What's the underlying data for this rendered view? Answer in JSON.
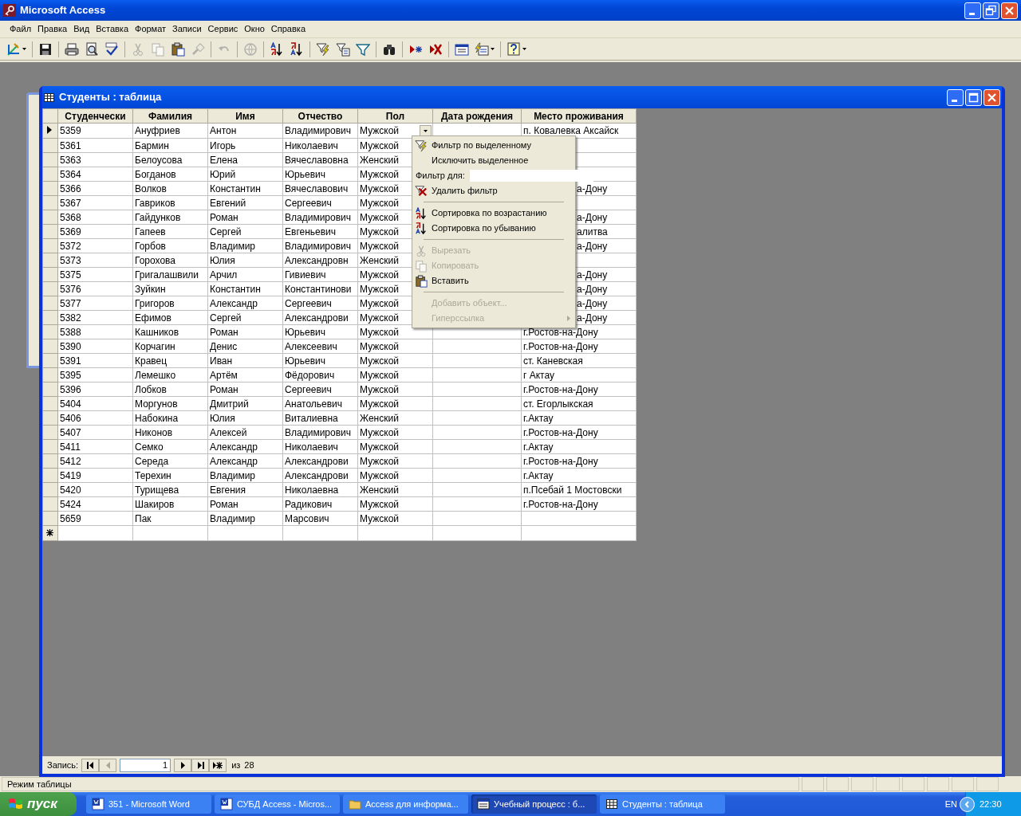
{
  "app": {
    "title": "Microsoft Access"
  },
  "menu_bar": [
    "Файл",
    "Правка",
    "Вид",
    "Вставка",
    "Формат",
    "Записи",
    "Сервис",
    "Окно",
    "Справка"
  ],
  "toolbar": [
    {
      "kind": "design-view",
      "disabled": false,
      "dropdown": true
    },
    {
      "kind": "save",
      "disabled": false,
      "dropdown": false
    },
    {
      "kind": "print",
      "disabled": false,
      "dropdown": false
    },
    {
      "kind": "preview",
      "disabled": false,
      "dropdown": false
    },
    {
      "kind": "spelling",
      "disabled": false,
      "dropdown": false
    },
    {
      "kind": "cut",
      "disabled": true,
      "dropdown": false
    },
    {
      "kind": "copy",
      "disabled": true,
      "dropdown": false
    },
    {
      "kind": "paste",
      "disabled": false,
      "dropdown": false
    },
    {
      "kind": "brush",
      "disabled": true,
      "dropdown": false
    },
    {
      "kind": "undo",
      "disabled": true,
      "dropdown": false
    },
    {
      "kind": "globe",
      "disabled": true,
      "dropdown": false
    },
    {
      "kind": "sort-asc",
      "disabled": false,
      "dropdown": false
    },
    {
      "kind": "sort-desc",
      "disabled": false,
      "dropdown": false
    },
    {
      "kind": "filter-selection",
      "disabled": false,
      "dropdown": false
    },
    {
      "kind": "filter-form",
      "disabled": false,
      "dropdown": false
    },
    {
      "kind": "filter",
      "disabled": false,
      "dropdown": false
    },
    {
      "kind": "find",
      "disabled": false,
      "dropdown": false
    },
    {
      "kind": "new-record",
      "disabled": false,
      "dropdown": false
    },
    {
      "kind": "delete-record",
      "disabled": false,
      "dropdown": false
    },
    {
      "kind": "database",
      "disabled": false,
      "dropdown": false
    },
    {
      "kind": "new-object",
      "disabled": false,
      "dropdown": true
    },
    {
      "kind": "help",
      "disabled": false,
      "dropdown": true
    }
  ],
  "table_window": {
    "title": "Студенты : таблица",
    "columns": [
      "Студенчески",
      "Фамилия",
      "Имя",
      "Отчество",
      "Пол",
      "Дата рождения",
      "Место проживания"
    ],
    "rows": [
      {
        "selected": true,
        "cells": [
          "5359",
          "Ануфриев",
          "Антон",
          "Владимирович",
          "Мужской",
          "",
          "п. Ковалевка Аксайск"
        ]
      },
      {
        "selected": false,
        "cells": [
          "5361",
          "Бармин",
          "Игорь",
          "Николаевич",
          "Мужской",
          "",
          ""
        ]
      },
      {
        "selected": false,
        "cells": [
          "5363",
          "Белоусова",
          "Елена",
          "Вячеславовна",
          "Женский",
          "",
          ""
        ]
      },
      {
        "selected": false,
        "cells": [
          "5364",
          "Богданов",
          "Юрий",
          "Юрьевич",
          "Мужской",
          "",
          ""
        ]
      },
      {
        "selected": false,
        "cells": [
          "5366",
          "Волков",
          "Константин",
          "Вячеславович",
          "Мужской",
          "",
          "а-Дону"
        ]
      },
      {
        "selected": false,
        "cells": [
          "5367",
          "Гавриков",
          "Евгений",
          "Сергеевич",
          "Мужской",
          "",
          ""
        ]
      },
      {
        "selected": false,
        "cells": [
          "5368",
          "Гайдунков",
          "Роман",
          "Владимирович",
          "Мужской",
          "",
          "а-Дону"
        ]
      },
      {
        "selected": false,
        "cells": [
          "5369",
          "Гапеев",
          "Сергей",
          "Евгеньевич",
          "Мужской",
          "",
          "алитва"
        ]
      },
      {
        "selected": false,
        "cells": [
          "5372",
          "Горбов",
          "Владимир",
          "Владимирович",
          "Мужской",
          "",
          "а-Дону"
        ]
      },
      {
        "selected": false,
        "cells": [
          "5373",
          "Горохова",
          "Юлия",
          "Александровн",
          "Женский",
          "",
          ""
        ]
      },
      {
        "selected": false,
        "cells": [
          "5375",
          "Григалашвили",
          "Арчил",
          "Гивиевич",
          "Мужской",
          "",
          "а-Дону"
        ]
      },
      {
        "selected": false,
        "cells": [
          "5376",
          "Зуйкин",
          "Константин",
          "Константинови",
          "Мужской",
          "",
          "а-Дону"
        ]
      },
      {
        "selected": false,
        "cells": [
          "5377",
          "Григоров",
          "Александр",
          "Сергеевич",
          "Мужской",
          "",
          "а-Дону"
        ]
      },
      {
        "selected": false,
        "cells": [
          "5382",
          "Ефимов",
          "Сергей",
          "Александрови",
          "Мужской",
          "",
          "а-Дону"
        ]
      },
      {
        "selected": false,
        "cells": [
          "5388",
          "Кашников",
          "Роман",
          "Юрьевич",
          "Мужской",
          "",
          "г.Ростов-на-Дону"
        ]
      },
      {
        "selected": false,
        "cells": [
          "5390",
          "Корчагин",
          "Денис",
          "Алексеевич",
          "Мужской",
          "",
          "г.Ростов-на-Дону"
        ]
      },
      {
        "selected": false,
        "cells": [
          "5391",
          "Кравец",
          "Иван",
          "Юрьевич",
          "Мужской",
          "",
          "ст. Каневская"
        ]
      },
      {
        "selected": false,
        "cells": [
          "5395",
          "Лемешко",
          "Артём",
          "Фёдорович",
          "Мужской",
          "",
          "г Актау"
        ]
      },
      {
        "selected": false,
        "cells": [
          "5396",
          "Лобков",
          "Роман",
          "Сергеевич",
          "Мужской",
          "",
          "г.Ростов-на-Дону"
        ]
      },
      {
        "selected": false,
        "cells": [
          "5404",
          "Моргунов",
          "Дмитрий",
          "Анатольевич",
          "Мужской",
          "",
          "ст. Егорлыкская"
        ]
      },
      {
        "selected": false,
        "cells": [
          "5406",
          "Набокина",
          "Юлия",
          "Виталиевна",
          "Женский",
          "",
          "г.Актау"
        ]
      },
      {
        "selected": false,
        "cells": [
          "5407",
          "Никонов",
          "Алексей",
          "Владимирович",
          "Мужской",
          "",
          "г.Ростов-на-Дону"
        ]
      },
      {
        "selected": false,
        "cells": [
          "5411",
          "Семко",
          "Александр",
          "Николаевич",
          "Мужской",
          "",
          "г.Актау"
        ]
      },
      {
        "selected": false,
        "cells": [
          "5412",
          "Середа",
          "Александр",
          "Александрови",
          "Мужской",
          "",
          "г.Ростов-на-Дону"
        ]
      },
      {
        "selected": false,
        "cells": [
          "5419",
          "Терехин",
          "Владимир",
          "Александрови",
          "Мужской",
          "",
          "г.Актау"
        ]
      },
      {
        "selected": false,
        "cells": [
          "5420",
          "Турищева",
          "Евгения",
          "Николаевна",
          "Женский",
          "",
          "п.Псебай 1 Мостовски"
        ]
      },
      {
        "selected": false,
        "cells": [
          "5424",
          "Шакиров",
          "Роман",
          "Радикович",
          "Мужской",
          "",
          "г.Ростов-на-Дону"
        ]
      },
      {
        "selected": false,
        "cells": [
          "5659",
          "Пак",
          "Владимир",
          "Марсович",
          "Мужской",
          "",
          ""
        ]
      }
    ],
    "navigator": {
      "label": "Запись:",
      "buttons": [
        {
          "kind": "first",
          "disabled": false
        },
        {
          "kind": "prev",
          "disabled": true
        },
        {
          "kind": "field"
        },
        {
          "kind": "next",
          "disabled": false
        },
        {
          "kind": "last",
          "disabled": false
        },
        {
          "kind": "new",
          "disabled": false
        }
      ],
      "current": "1",
      "of": "из",
      "total": "28"
    }
  },
  "context_menu": [
    {
      "kind": "filter-selection",
      "label": "Фильтр по выделенному",
      "disabled": false
    },
    {
      "kind": "plain",
      "label": "Исключить выделенное",
      "disabled": false
    },
    {
      "kind": "field",
      "label": "Фильтр для:"
    },
    {
      "kind": "remove-filter",
      "label": "Удалить фильтр",
      "disabled": false
    },
    {
      "kind": "separator"
    },
    {
      "kind": "sort-asc",
      "label": "Сортировка по возрастанию",
      "disabled": false
    },
    {
      "kind": "sort-desc",
      "label": "Сортировка по убыванию",
      "disabled": false
    },
    {
      "kind": "separator"
    },
    {
      "kind": "cut",
      "label": "Вырезать",
      "disabled": true
    },
    {
      "kind": "copy",
      "label": "Копировать",
      "disabled": true
    },
    {
      "kind": "paste",
      "label": "Вставить",
      "disabled": false
    },
    {
      "kind": "separator"
    },
    {
      "kind": "plain",
      "label": "Добавить объект...",
      "disabled": true
    },
    {
      "kind": "submenu",
      "label": "Гиперссылка",
      "disabled": true
    }
  ],
  "status_bar": {
    "text": "Режим таблицы"
  },
  "taskbar": {
    "start": "пуск",
    "tasks": [
      {
        "kind": "word",
        "label": "351 - Microsoft Word",
        "selected": false
      },
      {
        "kind": "word",
        "label": "СУБД Access - Micros...",
        "selected": false
      },
      {
        "kind": "folder",
        "label": "Access для информа...",
        "selected": false
      },
      {
        "kind": "database",
        "label": "Учебный процесс : б...",
        "selected": true
      },
      {
        "kind": "table",
        "label": "Студенты : таблица",
        "selected": false
      }
    ],
    "language": "EN",
    "clock": "22:30"
  }
}
